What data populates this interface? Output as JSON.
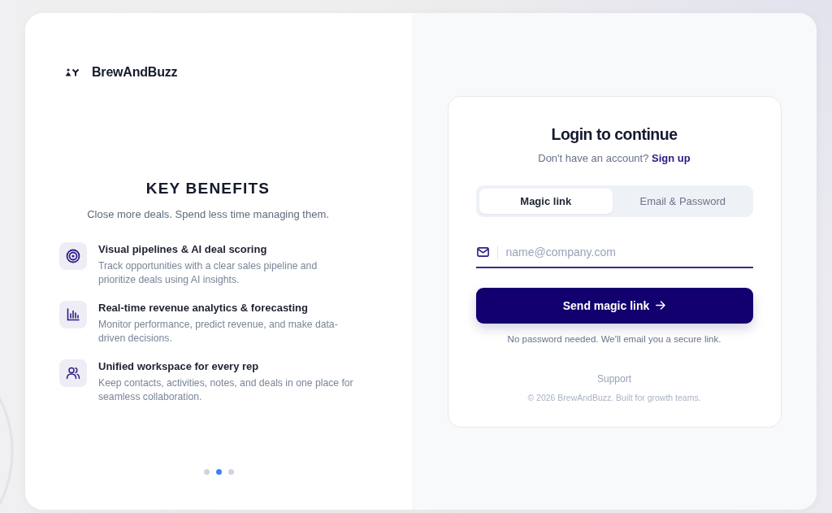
{
  "brand": {
    "name": "BrewAndBuzz"
  },
  "benefits": {
    "title": "KEY BENEFITS",
    "subtitle": "Close more deals. Spend less time managing them.",
    "items": [
      {
        "kind": "target",
        "title": "Visual pipelines & AI deal scoring",
        "description": "Track opportunities with a clear sales pipeline and prioritize deals using AI insights."
      },
      {
        "kind": "chart",
        "title": "Real-time revenue analytics & forecasting",
        "description": "Monitor performance, predict revenue, and make data-driven decisions."
      },
      {
        "kind": "team",
        "title": "Unified workspace for every rep",
        "description": "Keep contacts, activities, notes, and deals in one place for seamless collaboration."
      }
    ]
  },
  "carousel": {
    "dots": [
      {
        "selected": false
      },
      {
        "selected": true
      },
      {
        "selected": false
      }
    ]
  },
  "login": {
    "title": "Login to continue",
    "prompt": "Don't have an account?",
    "signup_link": "Sign up",
    "tabs": [
      {
        "label": "Magic link",
        "selected": true
      },
      {
        "label": "Email & Password",
        "selected": false
      }
    ],
    "email_field": {
      "placeholder": "name@company.com"
    },
    "submit_button": "Send magic link",
    "note": "No password needed. We'll email you a secure link.",
    "support_link": "Support",
    "copyright": "© 2026 BrewAndBuzz. Built for growth teams."
  }
}
